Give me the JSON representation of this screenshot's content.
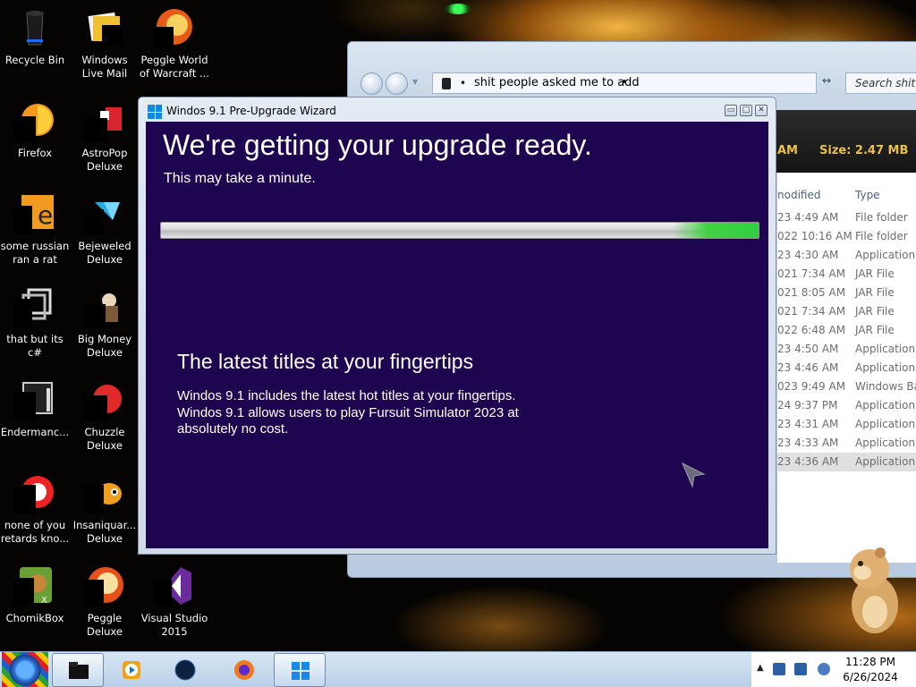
{
  "desktop": {
    "icons": [
      {
        "label": "Recycle Bin",
        "icon": "recycle-bin-icon"
      },
      {
        "label": "Windows Live Mail",
        "icon": "mail-icon"
      },
      {
        "label": "Peggle World of Warcraft ...",
        "icon": "peggle-icon"
      },
      {
        "label": "Firefox",
        "icon": "firefox-icon"
      },
      {
        "label": "AstroPop Deluxe",
        "icon": "game-icon"
      },
      {
        "label": "some russian ran a rat",
        "icon": "app-icon"
      },
      {
        "label": "Bejeweled Deluxe",
        "icon": "gem-icon"
      },
      {
        "label": "that but its c#",
        "icon": "shortcut-icon"
      },
      {
        "label": "Big Money Deluxe",
        "icon": "game-icon"
      },
      {
        "label": "Endermanc...",
        "icon": "app-icon"
      },
      {
        "label": "Chuzzle Deluxe",
        "icon": "game-icon"
      },
      {
        "label": "none of you retards kno...",
        "icon": "app-icon"
      },
      {
        "label": "Insaniquar... Deluxe",
        "icon": "fish-icon"
      },
      {
        "label": "ChomikBox",
        "icon": "hamster-icon"
      },
      {
        "label": "Peggle Deluxe",
        "icon": "peggle-icon"
      },
      {
        "label": "Visual Studio 2015",
        "icon": "visual-studio-icon"
      }
    ]
  },
  "explorer": {
    "address": "shit people asked me to add",
    "search_placeholder": "Search shit peop",
    "details_date_fragment": "AM",
    "details_size": "Size: 2.47 MB",
    "columns": {
      "modified": "nodified",
      "type": "Type"
    },
    "rows": [
      {
        "date": "23 4:49 AM",
        "type": "File folder"
      },
      {
        "date": "022 10:16 AM",
        "type": "File folder"
      },
      {
        "date": "23 4:30 AM",
        "type": "Application"
      },
      {
        "date": "021 7:34 AM",
        "type": "JAR File"
      },
      {
        "date": "021 8:05 AM",
        "type": "JAR File"
      },
      {
        "date": "021 7:34 AM",
        "type": "JAR File"
      },
      {
        "date": "022 6:48 AM",
        "type": "JAR File"
      },
      {
        "date": "23 4:50 AM",
        "type": "Application"
      },
      {
        "date": "23 4:46 AM",
        "type": "Application"
      },
      {
        "date": "023 9:49 AM",
        "type": "Windows Bat"
      },
      {
        "date": "24 9:37 PM",
        "type": "Application"
      },
      {
        "date": "23 4:31 AM",
        "type": "Application"
      },
      {
        "date": "23 4:33 AM",
        "type": "Application"
      },
      {
        "date": "23 4:36 AM",
        "type": "Application"
      }
    ]
  },
  "wizard": {
    "title": "Windos 9.1 Pre-Upgrade Wizard",
    "heading": "We're getting your upgrade ready.",
    "subheading": "This may take a minute.",
    "progress_fraction": 0.95,
    "feature_title": "The latest titles at your fingertips",
    "feature_lines": [
      "Windos 9.1 includes the latest hot titles at your fingertips.",
      "Windos 9.1 allows users to play Fursuit Simulator 2023 at",
      "absolutely no cost."
    ],
    "controls": {
      "minimize": "▭",
      "maximize": "□",
      "close": "✕"
    }
  },
  "taskbar": {
    "items": [
      {
        "name": "taskbar-item-folder",
        "icon": "folder-icon",
        "active": true
      },
      {
        "name": "taskbar-item-media-player",
        "icon": "media-player-icon",
        "active": false
      },
      {
        "name": "taskbar-item-browser-globe",
        "icon": "globe-icon",
        "active": false
      },
      {
        "name": "taskbar-item-firefox",
        "icon": "firefox-icon",
        "active": false
      },
      {
        "name": "taskbar-item-windows",
        "icon": "windows-logo-icon",
        "active": true
      }
    ],
    "time": "11:28 PM",
    "date": "6/26/2024"
  }
}
